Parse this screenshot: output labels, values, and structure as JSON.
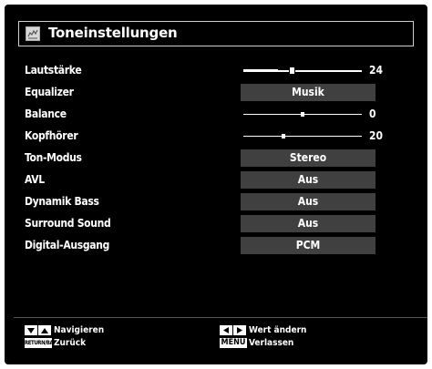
{
  "header": {
    "title": "Toneinstellungen",
    "icon": "sound-settings-icon"
  },
  "settings": [
    {
      "label": "Lautstärke",
      "type": "slider",
      "value": "24",
      "level": 0.3
    },
    {
      "label": "Equalizer",
      "type": "option",
      "value": "Musik"
    },
    {
      "label": "Balance",
      "type": "slider",
      "value": "0",
      "level": 0.5
    },
    {
      "label": "Kopfhörer",
      "type": "slider",
      "value": "20",
      "level": 0.33
    },
    {
      "label": "Ton-Modus",
      "type": "option",
      "value": "Stereo"
    },
    {
      "label": "AVL",
      "type": "option",
      "value": "Aus"
    },
    {
      "label": "Dynamik Bass",
      "type": "option",
      "value": "Aus"
    },
    {
      "label": "Surround Sound",
      "type": "option",
      "value": "Aus"
    },
    {
      "label": "Digital-Ausgang",
      "type": "option",
      "value": "PCM"
    }
  ],
  "footer": {
    "navigate_label": "Navigieren",
    "back_key": "RETURN/BACK",
    "back_label": "Zurück",
    "change_label": "Wert ändern",
    "menu_key": "MENU",
    "exit_label": "Verlassen"
  },
  "colors": {
    "background": "#000000",
    "option_bg": "#404040",
    "text": "#ffffff"
  }
}
